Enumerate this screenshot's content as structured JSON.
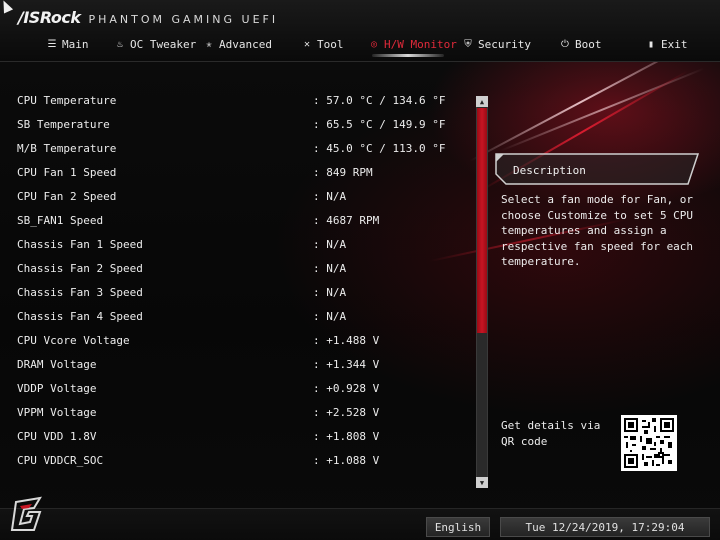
{
  "brand": {
    "name": "/ISRock",
    "subtitle": "PHANTOM GAMING UEFI"
  },
  "nav": [
    {
      "label": "Main",
      "icon": "list-icon"
    },
    {
      "label": "OC Tweaker",
      "icon": "flame-icon"
    },
    {
      "label": "Advanced",
      "icon": "star-icon"
    },
    {
      "label": "Tool",
      "icon": "tools-icon"
    },
    {
      "label": "H/W Monitor",
      "icon": "monitor-ring-icon",
      "active": true
    },
    {
      "label": "Security",
      "icon": "shield-icon"
    },
    {
      "label": "Boot",
      "icon": "power-icon"
    },
    {
      "label": "Exit",
      "icon": "exit-door-icon"
    }
  ],
  "monitor": {
    "rows": [
      {
        "label": "CPU Temperature",
        "value": ": 57.0 °C / 134.6 °F"
      },
      {
        "label": "SB Temperature",
        "value": ": 65.5 °C / 149.9 °F"
      },
      {
        "label": "M/B Temperature",
        "value": ": 45.0 °C / 113.0 °F"
      },
      {
        "label": "CPU Fan 1 Speed",
        "value": ": 849 RPM"
      },
      {
        "label": "CPU Fan 2 Speed",
        "value": ": N/A"
      },
      {
        "label": "SB_FAN1 Speed",
        "value": ": 4687 RPM"
      },
      {
        "label": "Chassis Fan 1 Speed",
        "value": ": N/A"
      },
      {
        "label": "Chassis Fan 2 Speed",
        "value": ": N/A"
      },
      {
        "label": "Chassis Fan 3 Speed",
        "value": ": N/A"
      },
      {
        "label": "Chassis Fan 4 Speed",
        "value": ": N/A"
      },
      {
        "label": "CPU Vcore Voltage",
        "value": ": +1.488 V"
      },
      {
        "label": "DRAM Voltage",
        "value": ": +1.344 V"
      },
      {
        "label": "VDDP Voltage",
        "value": ": +0.928 V"
      },
      {
        "label": "VPPM Voltage",
        "value": ": +2.528 V"
      },
      {
        "label": "CPU VDD 1.8V",
        "value": ": +1.808 V"
      },
      {
        "label": "CPU VDDCR_SOC",
        "value": ": +1.088 V"
      }
    ]
  },
  "description": {
    "title": "Description",
    "text": "Select a fan mode for Fan, or choose Customize to set 5 CPU temperatures and assign a respective fan speed for each temperature.",
    "qr_label": "Get details via QR code"
  },
  "footer": {
    "language": "English",
    "datetime": "Tue 12/24/2019, 17:29:04"
  },
  "colors": {
    "accent": "#e02a3a",
    "scroll_thumb": "#c71523",
    "background": "#050505"
  }
}
